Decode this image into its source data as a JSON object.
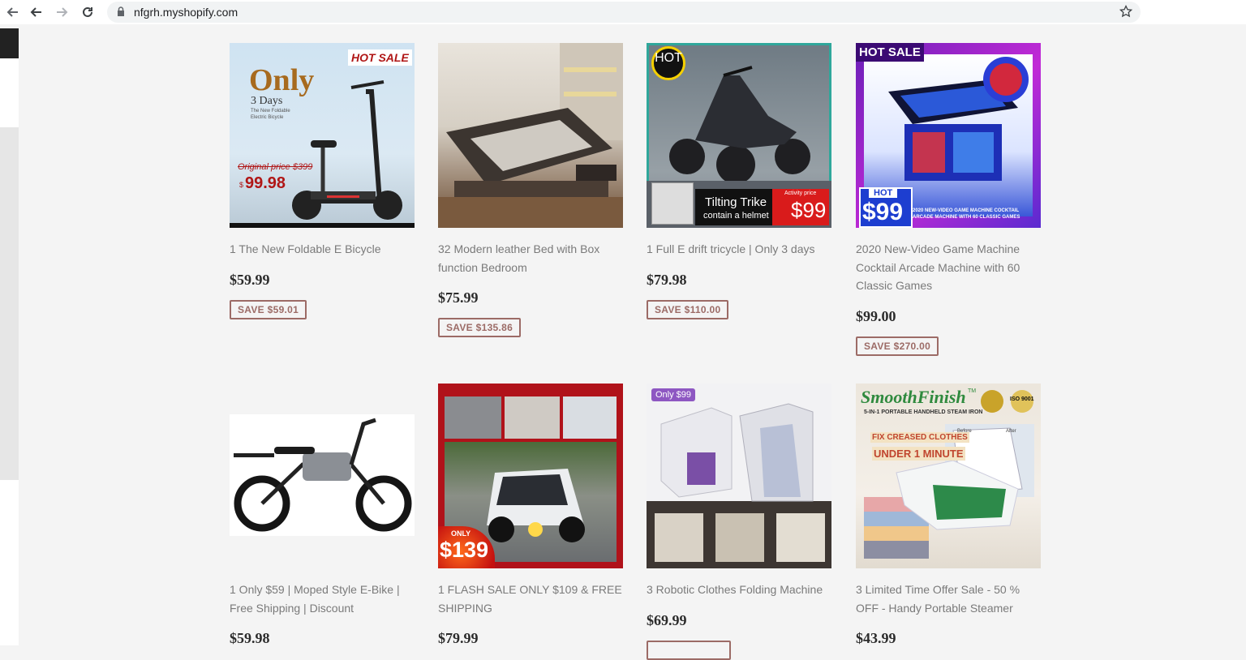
{
  "browser": {
    "url": "nfgrh.myshopify.com"
  },
  "products": [
    {
      "title": "1 The New Foldable E Bicycle",
      "price": "$59.99",
      "save": "SAVE $59.01",
      "image": {
        "badge": "HOT SALE",
        "headline": "Only",
        "sub": "3 Days",
        "caption": "The New Foldable Electric Bicycle",
        "original": "Original price $399",
        "currency": "$",
        "price": "99.98"
      }
    },
    {
      "title": "32 Modern leather Bed with Box function Bedroom",
      "price": "$75.99",
      "save": "SAVE $135.86"
    },
    {
      "title": "1 Full E drift tricycle | Only 3 days",
      "price": "$79.98",
      "save": "SAVE $110.00",
      "image": {
        "badge": "HOT",
        "name": "Tilting Trike",
        "note": "contain a helmet",
        "activity": "Activity price",
        "price": "$99"
      }
    },
    {
      "title": "2020 New-Video Game Machine Cocktail Arcade Machine with 60 Classic Games",
      "price": "$99.00",
      "save": "SAVE $270.00",
      "image": {
        "badge": "HOT SALE",
        "hot": "HOT",
        "price": "$99",
        "caption": "2020 NEW-VIDEO GAME MACHINE COCKTAIL ARCADE MACHINE WITH 60 CLASSIC GAMES"
      }
    },
    {
      "title": "1 Only $59 | Moped Style E-Bike | Free Shipping | Discount",
      "price": "$59.98"
    },
    {
      "title": "1 FLASH SALE ONLY $109 & FREE SHIPPING",
      "price": "$79.99",
      "image": {
        "only": "ONLY",
        "price": "$139"
      }
    },
    {
      "title": "3 Robotic Clothes Folding Machine",
      "price": "$69.99",
      "image": {
        "badge": "Only $99"
      }
    },
    {
      "title": "3 Limited Time Offer Sale - 50 % OFF - Handy Portable Steamer",
      "price": "$43.99",
      "image": {
        "brand": "SmoothFinish",
        "tm": "TM",
        "tagline": "5-IN-1 PORTABLE HANDHELD STEAM IRON",
        "promo1": "FIX CREASED CLOTHES",
        "promo2": "UNDER 1 MINUTE",
        "iso": "ISO 9001",
        "before": "Before",
        "after": "After"
      }
    }
  ],
  "colors": {
    "save_border": "#9c6b66",
    "title_text": "#7a7a7a",
    "price_text": "#2b2b2b",
    "page_bg": "#f4f4f4"
  }
}
